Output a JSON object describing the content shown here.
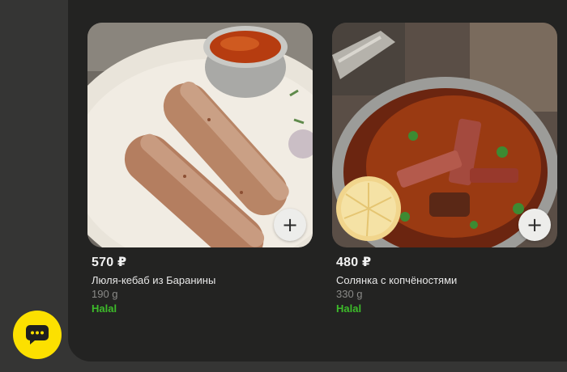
{
  "products": [
    {
      "price": "570 ₽",
      "name": "Люля-кебаб из Баранины",
      "weight": "190 g",
      "badge": "Halal",
      "add_label": "+",
      "image": "lula-kebab-photo"
    },
    {
      "price": "480 ₽",
      "name": "Солянка с копчёностями",
      "weight": "330 g",
      "badge": "Halal",
      "add_label": "+",
      "image": "solyanka-photo"
    }
  ],
  "support": {
    "icon": "chat-icon"
  },
  "colors": {
    "accent": "#fce000",
    "halal_badge": "#3dbb2a",
    "panel": "#232322",
    "background": "#353534"
  }
}
